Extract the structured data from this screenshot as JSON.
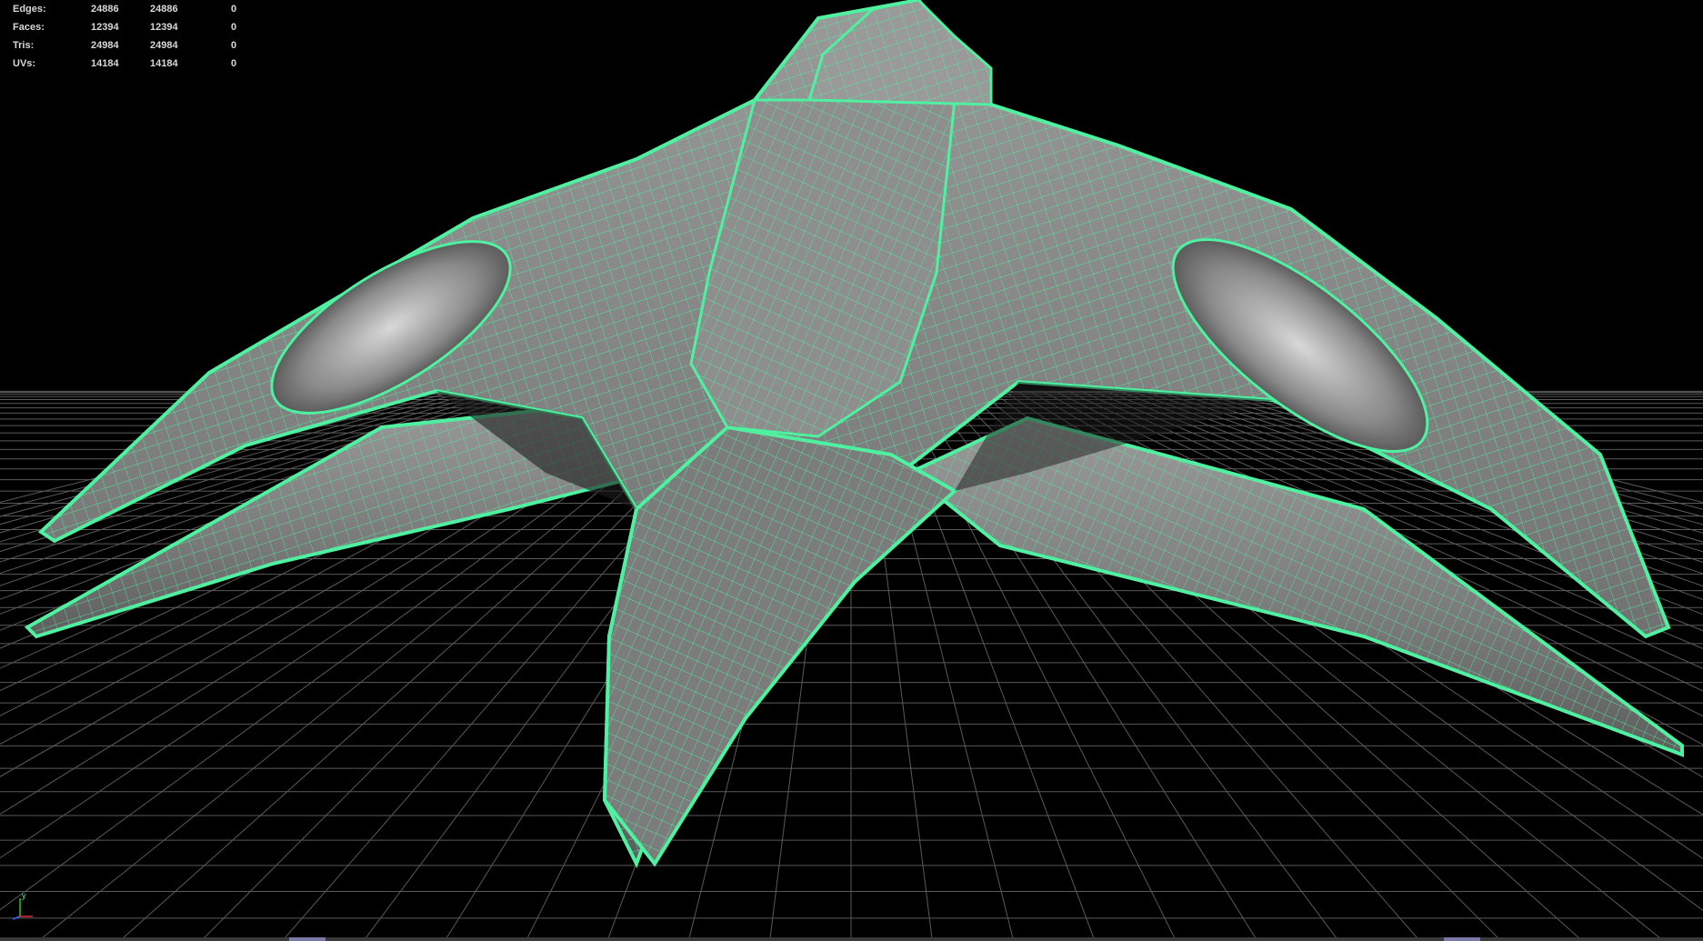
{
  "hud": {
    "rows": [
      {
        "label": "Edges:",
        "c1": "24886",
        "c2": "24886",
        "c3": "0"
      },
      {
        "label": "Faces:",
        "c1": "12394",
        "c2": "12394",
        "c3": "0"
      },
      {
        "label": "Tris:",
        "c1": "24984",
        "c2": "24984",
        "c3": "0"
      },
      {
        "label": "UVs:",
        "c1": "14184",
        "c2": "14184",
        "c3": "0"
      }
    ]
  },
  "axis": {
    "y_label": "y",
    "x_color": "#e03030",
    "y_color": "#30c030",
    "z_color": "#4060ff"
  },
  "colors": {
    "background": "#000000",
    "wireframe": "#4ff0a0",
    "surface": "#8a8a8a",
    "grid": "#5a5a5a"
  }
}
